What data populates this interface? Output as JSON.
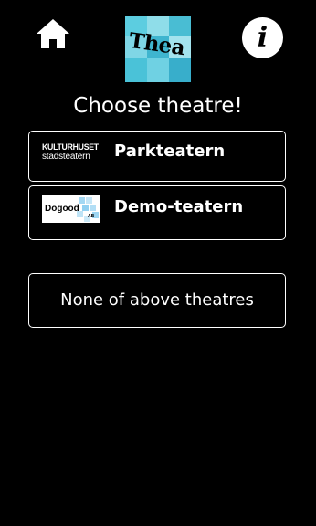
{
  "header": {
    "home_icon": "home-icon",
    "logo_text": "Thea",
    "info_glyph": "i",
    "info_icon": "info-icon"
  },
  "title": "Choose theatre!",
  "theatres": [
    {
      "logo_line1": "KULTURHUSET",
      "logo_line2": "stadsteatern",
      "name": "Parkteatern"
    },
    {
      "logo_text": "Dogood",
      "logo_suffix": "AB",
      "name": "Demo-teatern"
    }
  ],
  "none_option": "None of above theatres",
  "colors": {
    "background": "#000000",
    "text": "#ffffff",
    "logo_accent": "#4fc6db",
    "dogood_accent": "#7ec8ee"
  }
}
